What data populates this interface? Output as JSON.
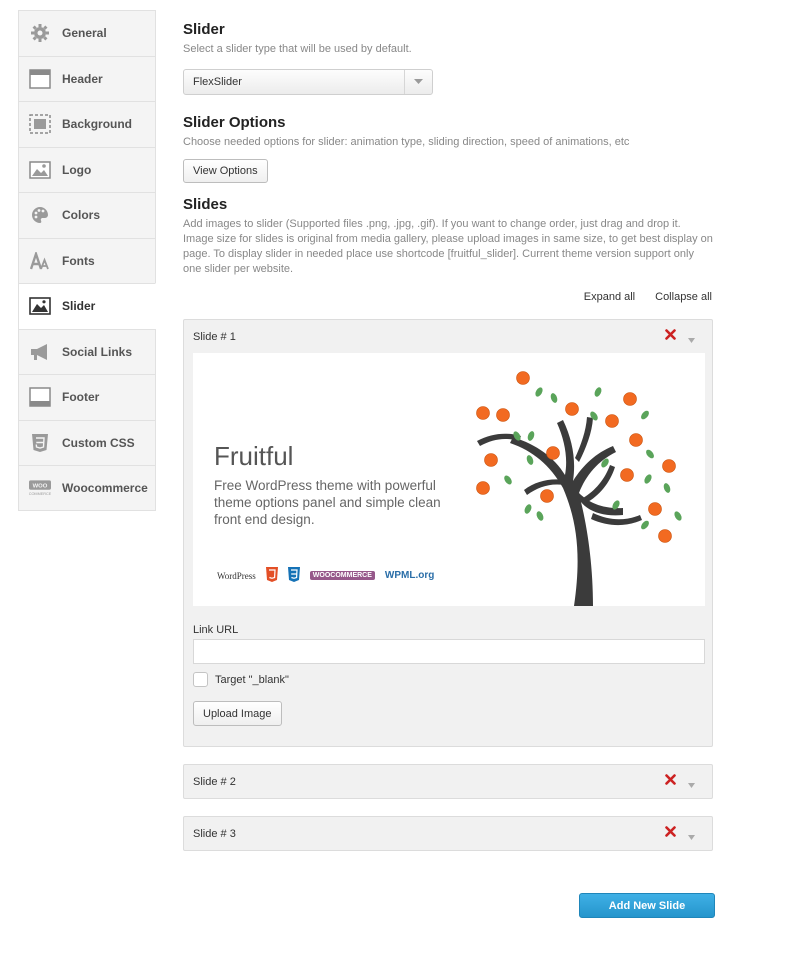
{
  "sidebar": {
    "items": [
      {
        "label": "General",
        "icon": "gear-icon"
      },
      {
        "label": "Header",
        "icon": "header-icon"
      },
      {
        "label": "Background",
        "icon": "background-icon"
      },
      {
        "label": "Logo",
        "icon": "logo-image-icon"
      },
      {
        "label": "Colors",
        "icon": "palette-icon"
      },
      {
        "label": "Fonts",
        "icon": "fonts-icon"
      },
      {
        "label": "Slider",
        "icon": "slider-icon",
        "active": true
      },
      {
        "label": "Social Links",
        "icon": "megaphone-icon"
      },
      {
        "label": "Footer",
        "icon": "footer-icon"
      },
      {
        "label": "Custom CSS",
        "icon": "css3-icon"
      },
      {
        "label": "Woocommerce",
        "icon": "woocommerce-icon"
      }
    ]
  },
  "slider": {
    "title": "Slider",
    "description": "Select a slider type that will be used by default.",
    "selected": "FlexSlider"
  },
  "slider_options": {
    "title": "Slider Options",
    "description": "Choose needed options for slider: animation type, sliding direction, speed of animations, etc",
    "button": "View Options"
  },
  "slides": {
    "title": "Slides",
    "description": "Add images to slider (Supported files .png, .jpg, .gif). If you want to change order, just drag and drop it. Image size for slides is original from media gallery, please upload images in same size, to get best display on page. To display slider in needed place use shortcode [fruitful_slider]. Current theme version support only one slider per website.",
    "expand_all": "Expand all",
    "collapse_all": "Collapse all",
    "items": [
      {
        "title": "Slide # 1",
        "expanded": true
      },
      {
        "title": "Slide # 2",
        "expanded": false
      },
      {
        "title": "Slide # 3",
        "expanded": false
      }
    ],
    "link_url_label": "Link URL",
    "link_url_value": "",
    "target_label": "Target \"_blank\"",
    "upload_button": "Upload Image",
    "add_button": "Add New Slide"
  },
  "banner": {
    "title": "Fruitful",
    "subtitle": "Free WordPress theme with powerful theme options panel and simple clean front end design.",
    "logos": [
      "WordPress",
      "HTML5",
      "CSS3",
      "WooCommerce",
      "WPML.org"
    ]
  },
  "colors": {
    "accent": "#2a9ad1",
    "delete": "#cc2222",
    "orange": "#f26a21",
    "leaf": "#5aa45a",
    "trunk": "#3b3b3b"
  }
}
